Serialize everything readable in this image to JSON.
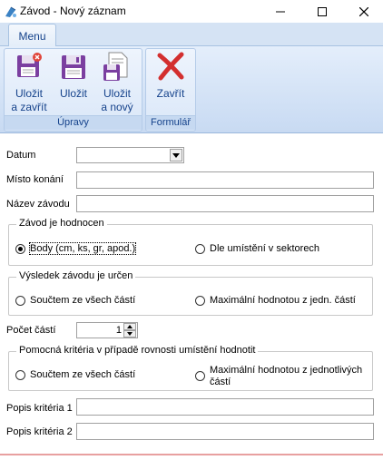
{
  "window": {
    "title": "Závod - Nový záznam",
    "minimize_icon": "minimize-icon",
    "maximize_icon": "maximize-icon",
    "close_icon": "close-icon"
  },
  "ribbon": {
    "tabs": [
      {
        "label": "Menu"
      }
    ],
    "groups": {
      "upravy": {
        "label": "Úpravy",
        "buttons": [
          {
            "line1": "Uložit",
            "line2": "a zavřít",
            "icon": "save-close-icon"
          },
          {
            "line1": "Uložit",
            "line2": "",
            "icon": "save-icon"
          },
          {
            "line1": "Uložit",
            "line2": "a nový",
            "icon": "save-new-icon"
          }
        ]
      },
      "formular": {
        "label": "Formulář",
        "buttons": [
          {
            "line1": "Zavřít",
            "line2": "",
            "icon": "close-x-icon"
          }
        ]
      }
    }
  },
  "form": {
    "datum": {
      "label": "Datum",
      "value": ""
    },
    "misto": {
      "label": "Místo konání",
      "value": ""
    },
    "nazev": {
      "label": "Název závodu",
      "value": ""
    },
    "hodnocen": {
      "legend": "Závod je hodnocen",
      "options": [
        {
          "label": "Body (cm, ks, gr, apod.)",
          "selected": true
        },
        {
          "label": "Dle umístění v sektorech",
          "selected": false
        }
      ]
    },
    "vysledek": {
      "legend": "Výsledek závodu je určen",
      "options": [
        {
          "label": "Součtem ze všech částí",
          "selected": false
        },
        {
          "label": "Maximální hodnotou z jedn. částí",
          "selected": false
        }
      ]
    },
    "pocet": {
      "label": "Počet částí",
      "value": "1"
    },
    "kriteria": {
      "legend": "Pomocná kritéria v případě rovnosti umístění hodnotit",
      "options": [
        {
          "label": "Součtem ze všech částí",
          "selected": false
        },
        {
          "label": "Maximální hodnotou z jednotlivých částí",
          "selected": false
        }
      ]
    },
    "popis1": {
      "label": "Popis kritéria 1",
      "value": ""
    },
    "popis2": {
      "label": "Popis kritéria 2",
      "value": ""
    }
  },
  "colors": {
    "ribbon_text": "#15428b",
    "ribbon_bg": "#d5e3f4",
    "close_red": "#d32f2f"
  }
}
